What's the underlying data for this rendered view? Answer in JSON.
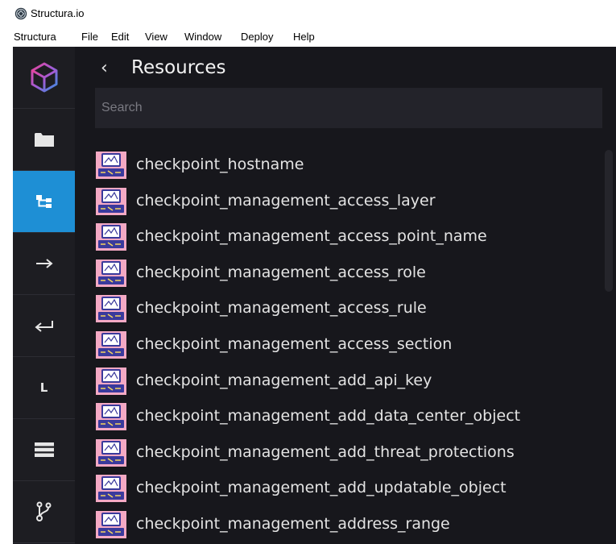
{
  "window": {
    "title": "Structura.io"
  },
  "menu": [
    "Structura",
    "File",
    "Edit",
    "View",
    "Window",
    "Deploy",
    "Help"
  ],
  "rail": {
    "active_index": 2,
    "items": [
      {
        "icon": "cube-logo-icon"
      },
      {
        "icon": "folder-icon"
      },
      {
        "icon": "hierarchy-icon"
      },
      {
        "icon": "arrow-right-icon"
      },
      {
        "icon": "return-arrow-icon"
      },
      {
        "icon": "letter-l-icon",
        "label": "L"
      },
      {
        "icon": "list-icon"
      },
      {
        "icon": "git-branch-icon"
      }
    ]
  },
  "panel": {
    "title": "Resources",
    "back_glyph": "‹",
    "search_placeholder": "Search"
  },
  "resources": [
    {
      "name": "checkpoint_hostname"
    },
    {
      "name": "checkpoint_management_access_layer"
    },
    {
      "name": "checkpoint_management_access_point_name"
    },
    {
      "name": "checkpoint_management_access_role"
    },
    {
      "name": "checkpoint_management_access_rule"
    },
    {
      "name": "checkpoint_management_access_section"
    },
    {
      "name": "checkpoint_management_add_api_key"
    },
    {
      "name": "checkpoint_management_add_data_center_object"
    },
    {
      "name": "checkpoint_management_add_threat_protections"
    },
    {
      "name": "checkpoint_management_add_updatable_object"
    },
    {
      "name": "checkpoint_management_address_range"
    }
  ],
  "colors": {
    "rail_active": "#1e8fd5",
    "background": "#17171c",
    "resource_icon_bg": "#f4a9c4",
    "resource_icon_screen": "#3a3a9c"
  }
}
